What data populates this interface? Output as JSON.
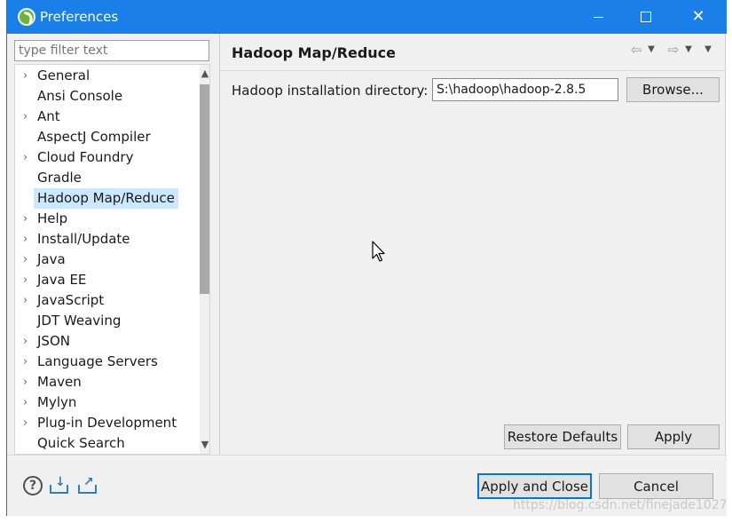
{
  "window": {
    "title": "Preferences",
    "minimize_glyph": "—",
    "maximize_glyph": "☐",
    "close_glyph": "✕"
  },
  "filter": {
    "placeholder": "type filter text"
  },
  "tree": {
    "items": [
      {
        "label": "General",
        "expandable": true
      },
      {
        "label": "Ansi Console",
        "expandable": false
      },
      {
        "label": "Ant",
        "expandable": true
      },
      {
        "label": "AspectJ Compiler",
        "expandable": false
      },
      {
        "label": "Cloud Foundry",
        "expandable": true
      },
      {
        "label": "Gradle",
        "expandable": false
      },
      {
        "label": "Hadoop Map/Reduce",
        "expandable": false,
        "selected": true
      },
      {
        "label": "Help",
        "expandable": true
      },
      {
        "label": "Install/Update",
        "expandable": true
      },
      {
        "label": "Java",
        "expandable": true
      },
      {
        "label": "Java EE",
        "expandable": true
      },
      {
        "label": "JavaScript",
        "expandable": true
      },
      {
        "label": "JDT Weaving",
        "expandable": false
      },
      {
        "label": "JSON",
        "expandable": true
      },
      {
        "label": "Language Servers",
        "expandable": true
      },
      {
        "label": "Maven",
        "expandable": true
      },
      {
        "label": "Mylyn",
        "expandable": true
      },
      {
        "label": "Plug-in Development",
        "expandable": true
      },
      {
        "label": "Quick Search",
        "expandable": false
      }
    ],
    "chevron_glyph": "›",
    "scroll_up_glyph": "▲",
    "scroll_down_glyph": "▼"
  },
  "panel": {
    "title": "Hadoop Map/Reduce",
    "nav_back_glyph": "⇦",
    "nav_forward_glyph": "⇨",
    "dropdown_glyph": "▼",
    "field_label": "Hadoop installation directory:",
    "install_dir_value": "S:\\hadoop\\hadoop-2.8.5",
    "browse_label": "Browse...",
    "restore_defaults_label": "Restore Defaults",
    "apply_label": "Apply"
  },
  "footer": {
    "help_glyph": "?",
    "import_glyph": "↓",
    "export_glyph": "↗",
    "apply_close_label": "Apply and Close",
    "cancel_label": "Cancel"
  },
  "watermark": "https://blog.csdn.net/finejade1027",
  "colors": {
    "title_bar": "#1a7fe8",
    "selection": "#cce8ff",
    "default_button_border": "#0078d7"
  }
}
